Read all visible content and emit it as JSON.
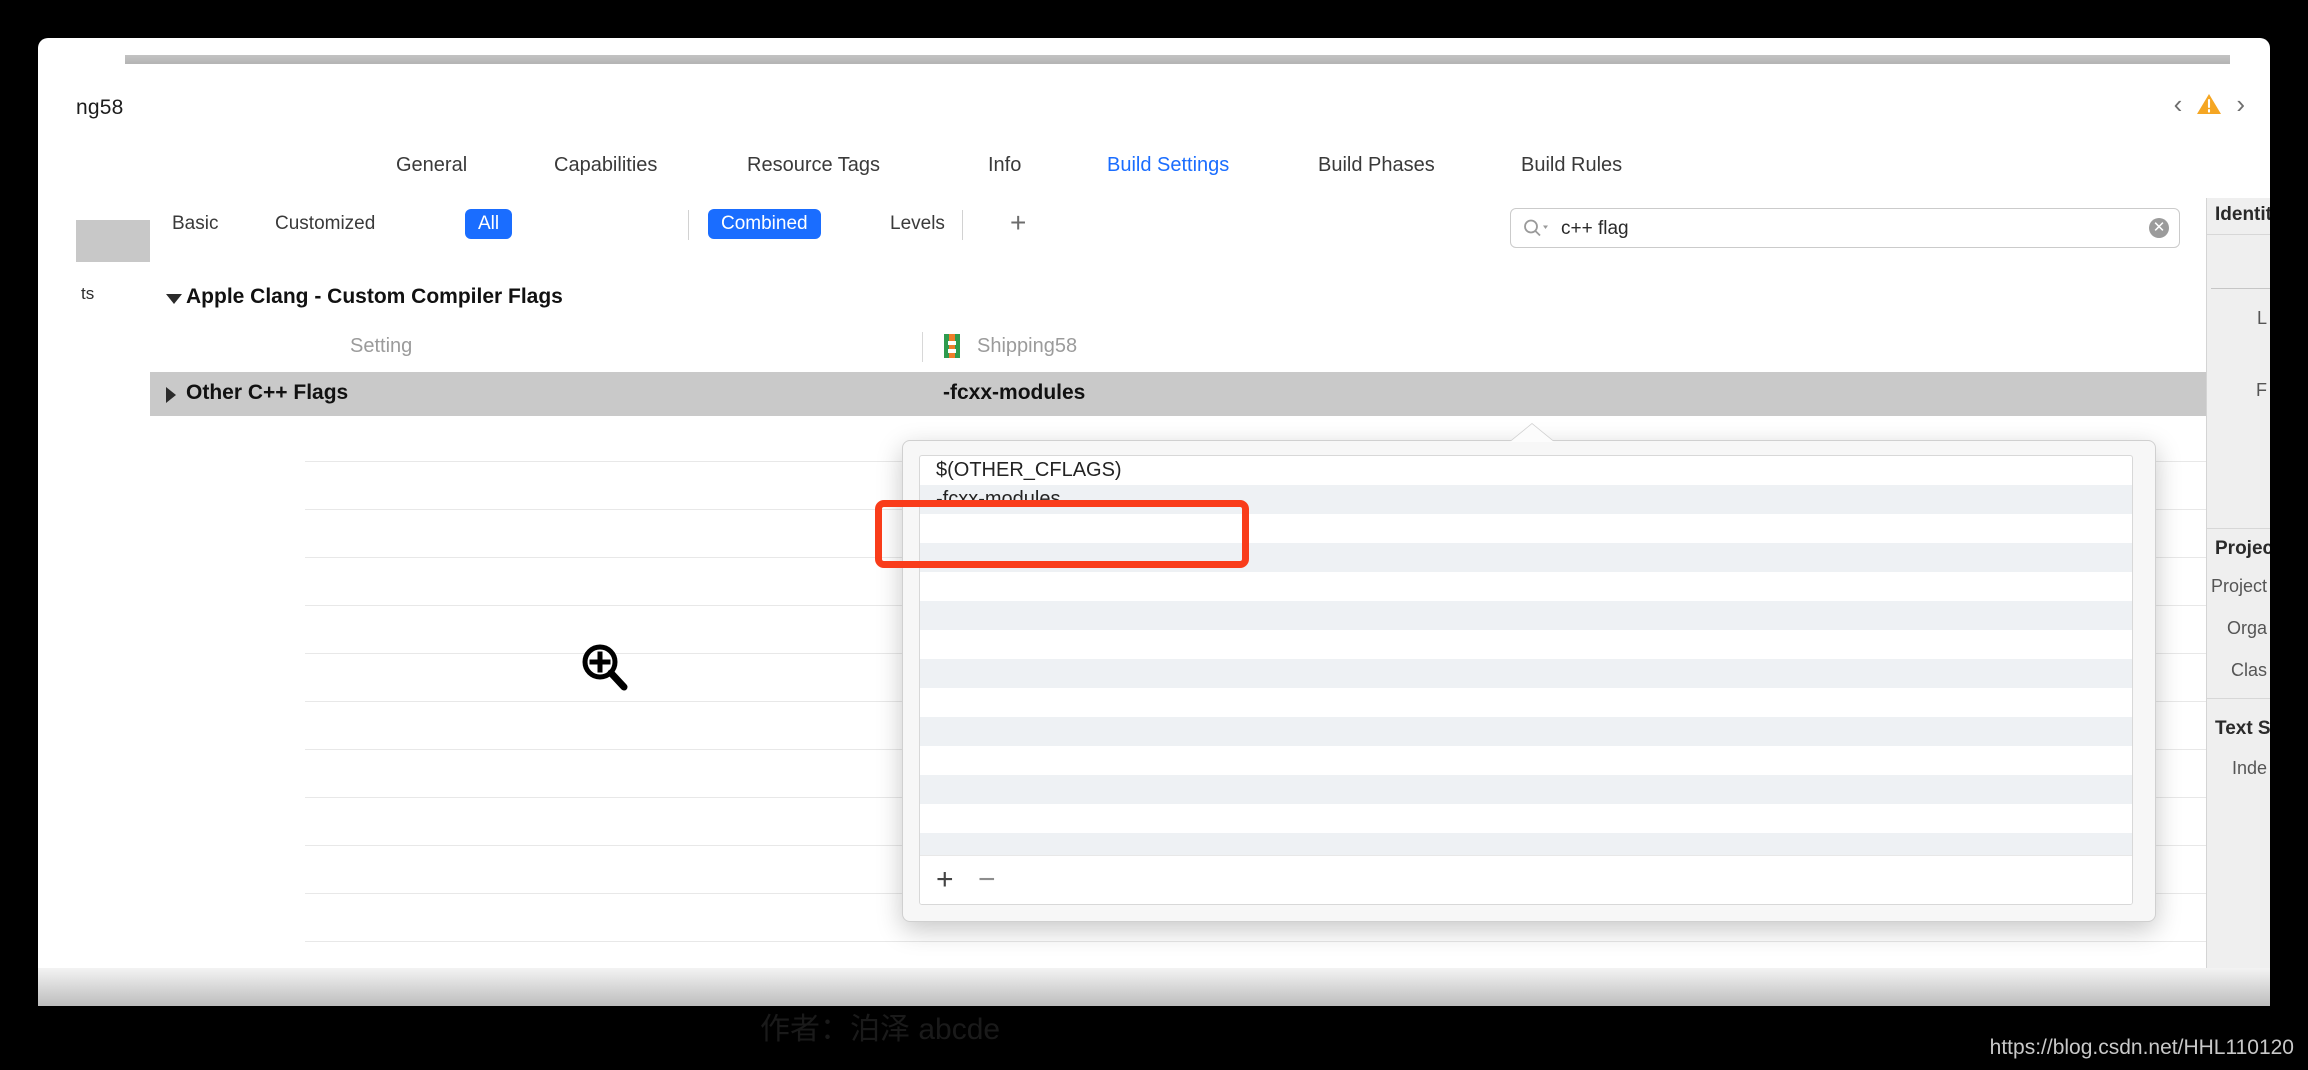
{
  "window": {
    "project_title": "ng58"
  },
  "nav": {
    "prev_icon": "chevron-left-icon",
    "warning_icon": "warning-triangle-icon",
    "next_icon": "chevron-right-icon"
  },
  "tabs": [
    {
      "label": "General",
      "active": false
    },
    {
      "label": "Capabilities",
      "active": false
    },
    {
      "label": "Resource Tags",
      "active": false
    },
    {
      "label": "Info",
      "active": false
    },
    {
      "label": "Build Settings",
      "active": true
    },
    {
      "label": "Build Phases",
      "active": false
    },
    {
      "label": "Build Rules",
      "active": false
    }
  ],
  "filter_bar": {
    "items": [
      {
        "label": "Basic",
        "style": "plain"
      },
      {
        "label": "Customized",
        "style": "plain"
      },
      {
        "label": "All",
        "style": "pill"
      },
      {
        "label": "Combined",
        "style": "pill"
      },
      {
        "label": "Levels",
        "style": "plain"
      }
    ],
    "add_label": "+"
  },
  "search": {
    "value": "c++ flag",
    "placeholder": "",
    "icon": "search-icon",
    "clear_label": "✕"
  },
  "left_gutter": {
    "label": "ts"
  },
  "settings_table": {
    "group_title": "Apple Clang - Custom Compiler Flags",
    "columns": {
      "setting": "Setting",
      "target": "Shipping58"
    },
    "rows": [
      {
        "name": "Other C++ Flags",
        "value": "-fcxx-modules"
      }
    ]
  },
  "popover": {
    "values": [
      "$(OTHER_CFLAGS)",
      "-fcxx-modules"
    ],
    "add_label": "+",
    "remove_label": "−"
  },
  "annotation": {
    "highlight_color": "#f93c1a",
    "highlighted_value": "-fcxx-modules"
  },
  "cursor": {
    "icon": "magnifier-plus-icon"
  },
  "inspector": {
    "sections": [
      {
        "heading": "Identity",
        "labels": [
          "L",
          "F"
        ]
      },
      {
        "heading": "Project",
        "labels": [
          "Project",
          "Orga",
          "Clas"
        ]
      },
      {
        "heading": "Text Se",
        "labels": [
          "Inde"
        ]
      }
    ]
  },
  "watermark": {
    "url": "https://blog.csdn.net/HHL110120",
    "author": "作者：泊泽 abcde"
  }
}
